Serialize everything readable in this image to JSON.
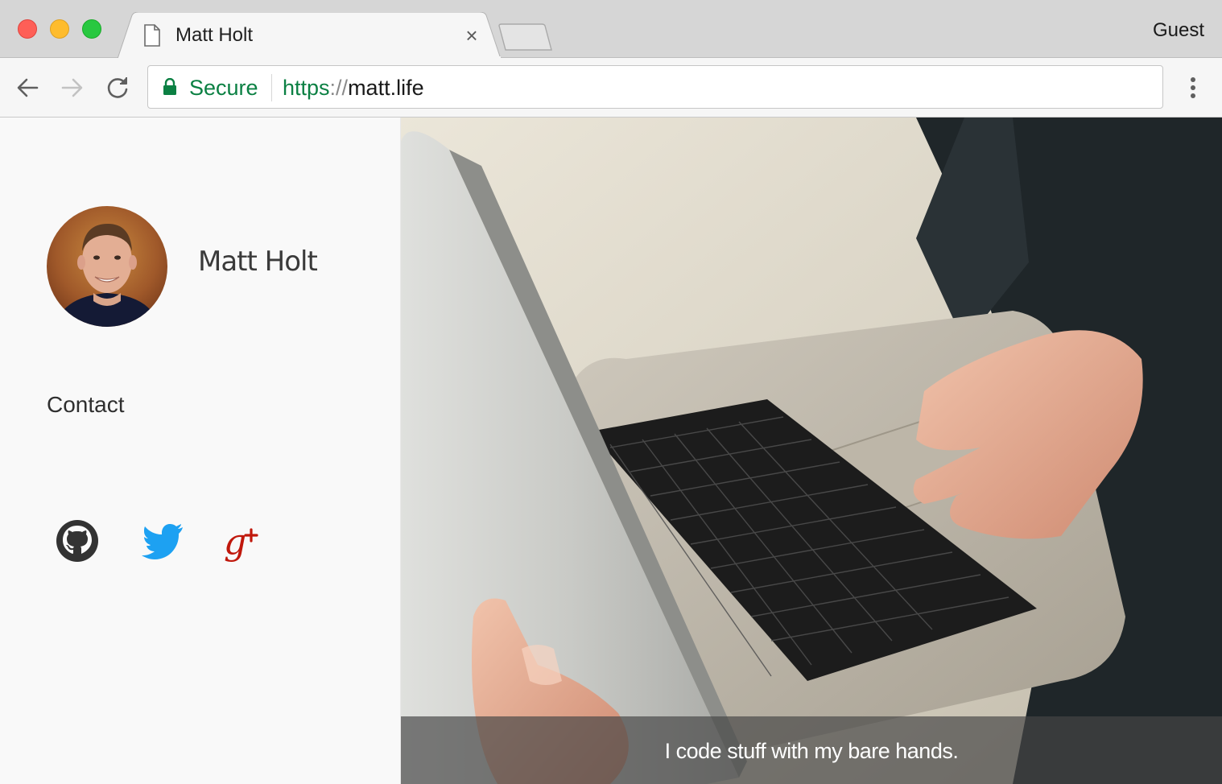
{
  "browser": {
    "tab_title": "Matt Holt",
    "tab_close": "×",
    "profile_label": "Guest",
    "security_label": "Secure",
    "url": {
      "scheme": "https",
      "separator": "://",
      "host": "matt.life"
    },
    "colors": {
      "secure_green": "#0b8043",
      "tabbar": "#d6d6d6",
      "toolbar": "#f6f6f6"
    }
  },
  "sidebar": {
    "avatar_icon": "avatar-photo",
    "name": "Matt Holt",
    "contact_label": "Contact",
    "social": [
      {
        "icon": "github-icon",
        "color": "#333333"
      },
      {
        "icon": "twitter-icon",
        "color": "#1da1f2"
      },
      {
        "icon": "google-plus-icon",
        "color": "#c0180c"
      }
    ]
  },
  "hero": {
    "image": "laptop-hands-photo",
    "caption": "I code stuff with my bare hands."
  }
}
